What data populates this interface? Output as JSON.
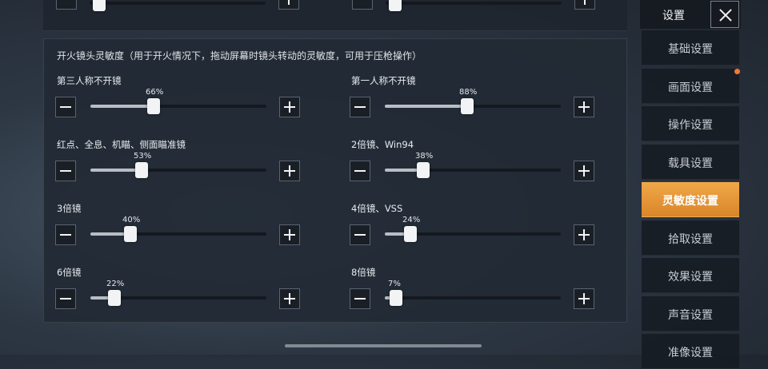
{
  "panel": {
    "title": "开火镜头灵敏度（用于开火情况下，拖动屏幕时镜头转动的灵敏度，可用于压枪操作）"
  },
  "sliders": [
    {
      "label": "第三人称不开镜",
      "value": 66,
      "display": "66%"
    },
    {
      "label": "第一人称不开镜",
      "value": 88,
      "display": "88%"
    },
    {
      "label": "红点、全息、机瞄、侧面瞄准镜",
      "value": 53,
      "display": "53%"
    },
    {
      "label": "2倍镜、Win94",
      "value": 38,
      "display": "38%"
    },
    {
      "label": "3倍镜",
      "value": 40,
      "display": "40%"
    },
    {
      "label": "4倍镜、VSS",
      "value": 24,
      "display": "24%"
    },
    {
      "label": "6倍镜",
      "value": 22,
      "display": "22%"
    },
    {
      "label": "8倍镜",
      "value": 7,
      "display": "7%"
    }
  ],
  "top_sliders": [
    {
      "value": 5
    },
    {
      "value": 5
    }
  ],
  "sidebar": {
    "title": "设置",
    "close_icon": "close-icon",
    "items": [
      {
        "label": "基础设置",
        "active": false
      },
      {
        "label": "画面设置",
        "active": false,
        "badge": true
      },
      {
        "label": "操作设置",
        "active": false
      },
      {
        "label": "载具设置",
        "active": false
      },
      {
        "label": "灵敏度设置",
        "active": true
      },
      {
        "label": "拾取设置",
        "active": false
      },
      {
        "label": "效果设置",
        "active": false
      },
      {
        "label": "声音设置",
        "active": false
      },
      {
        "label": "准像设置",
        "active": false
      }
    ]
  },
  "colors": {
    "accent": "#e8962f",
    "badge": "#f07830",
    "panel_bg": "#222a34"
  }
}
